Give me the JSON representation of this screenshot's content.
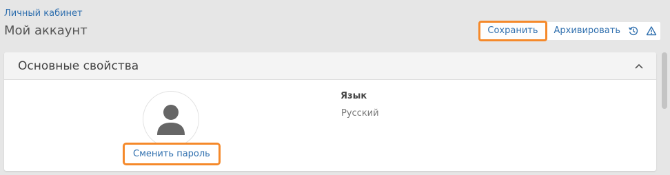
{
  "breadcrumb": {
    "label": "Личный кабинет"
  },
  "header": {
    "title": "Мой аккаунт"
  },
  "toolbar": {
    "save_label": "Сохранить",
    "archive_label": "Архивировать",
    "history_icon": "history-icon",
    "warning_icon": "warning-icon"
  },
  "panel": {
    "title": "Основные свойства",
    "collapse_icon": "chevron-up-icon",
    "avatar_icon": "user-icon",
    "change_password_label": "Сменить пароль",
    "language": {
      "label": "Язык",
      "value": "Русский"
    }
  },
  "colors": {
    "accent_link": "#2f6fae",
    "highlight_border": "#f5892a",
    "background": "#e6e6e6"
  }
}
